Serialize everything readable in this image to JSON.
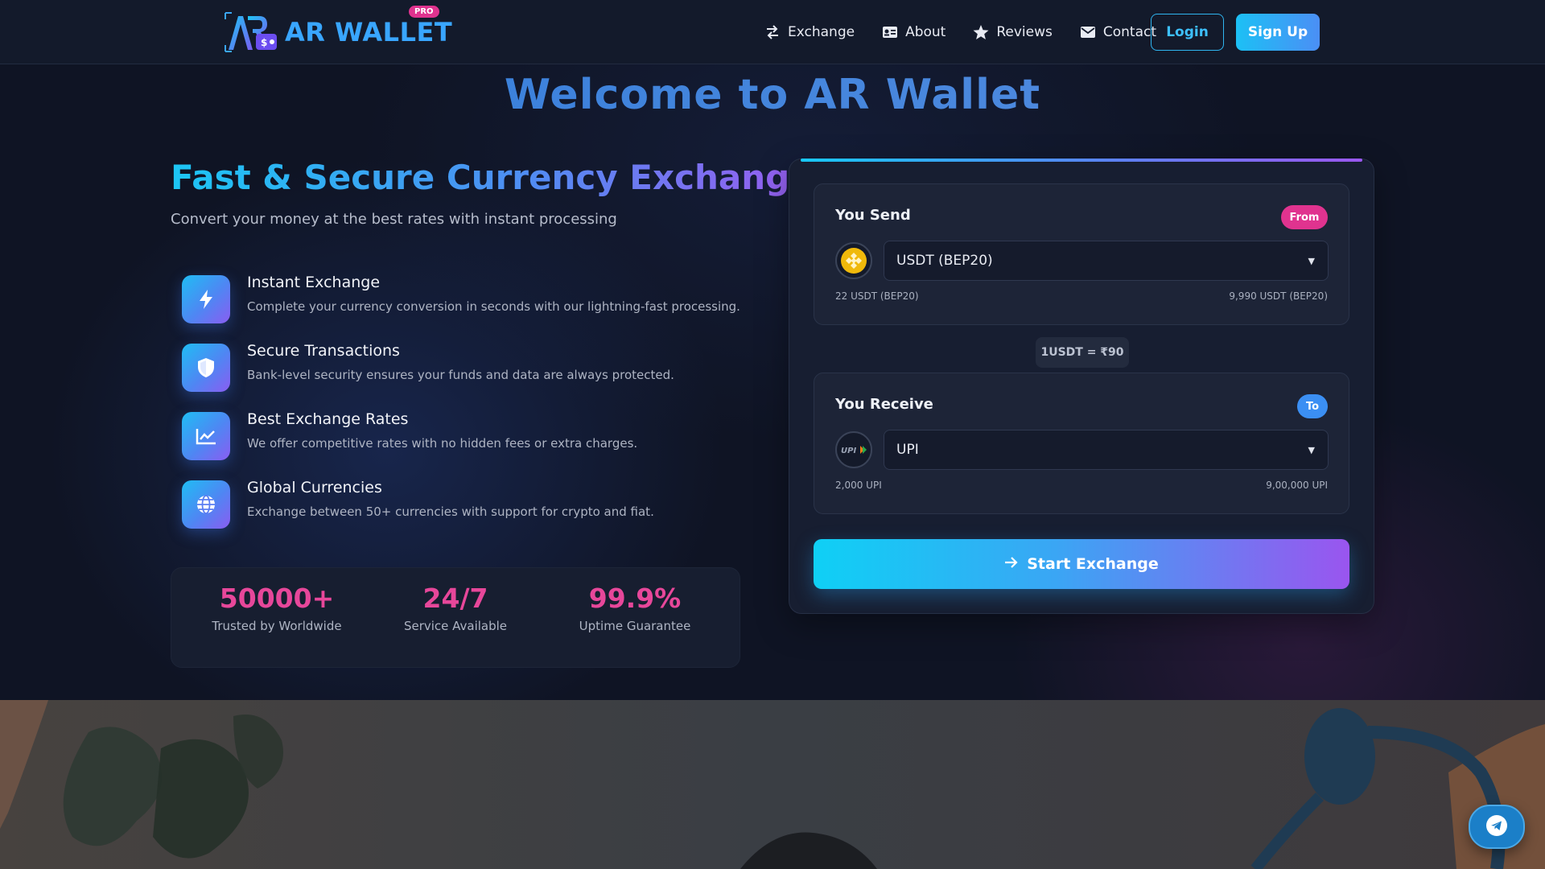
{
  "nav": {
    "brand": "AR WALLET",
    "pro_badge": "PRO",
    "links": [
      {
        "label": "Exchange",
        "icon": "exchange-icon"
      },
      {
        "label": "About",
        "icon": "id-card-icon"
      },
      {
        "label": "Reviews",
        "icon": "star-icon"
      },
      {
        "label": "Contact",
        "icon": "envelope-icon"
      }
    ],
    "login": "Login",
    "signup": "Sign Up"
  },
  "hero": {
    "welcome": "Welcome to AR Wallet",
    "title": "Fast & Secure Currency Exchange",
    "subtitle": "Convert your money at the best rates with instant processing",
    "features": [
      {
        "title": "Instant Exchange",
        "desc": "Complete your currency conversion in seconds with our lightning-fast processing.",
        "icon": "bolt-icon"
      },
      {
        "title": "Secure Transactions",
        "desc": "Bank-level security ensures your funds and data are always protected.",
        "icon": "shield-icon"
      },
      {
        "title": "Best Exchange Rates",
        "desc": "We offer competitive rates with no hidden fees or extra charges.",
        "icon": "chart-line-icon"
      },
      {
        "title": "Global Currencies",
        "desc": "Exchange between 50+ currencies with support for crypto and fiat.",
        "icon": "globe-icon"
      }
    ],
    "stats": [
      {
        "value": "50000+",
        "label": "Trusted by Worldwide"
      },
      {
        "value": "24/7",
        "label": "Service Available"
      },
      {
        "value": "99.9%",
        "label": "Uptime Guarantee"
      }
    ]
  },
  "exchange": {
    "send": {
      "title": "You Send",
      "badge": "From",
      "selected": "USDT (BEP20)",
      "min": "22 USDT (BEP20)",
      "max": "9,990 USDT (BEP20)",
      "icon": "bnb-coin-icon"
    },
    "rate": "1USDT = ₹90",
    "receive": {
      "title": "You Receive",
      "badge": "To",
      "selected": "UPI",
      "min": "2,000 UPI",
      "max": "9,00,000 UPI",
      "icon": "upi-logo-icon"
    },
    "button": "Start Exchange"
  },
  "colors": {
    "accent_cyan": "#1cc0f5",
    "accent_purple": "#9a55ef",
    "stat_pink": "#e7479a",
    "from_badge": "#e0338f",
    "to_badge": "#3b8ff3"
  }
}
